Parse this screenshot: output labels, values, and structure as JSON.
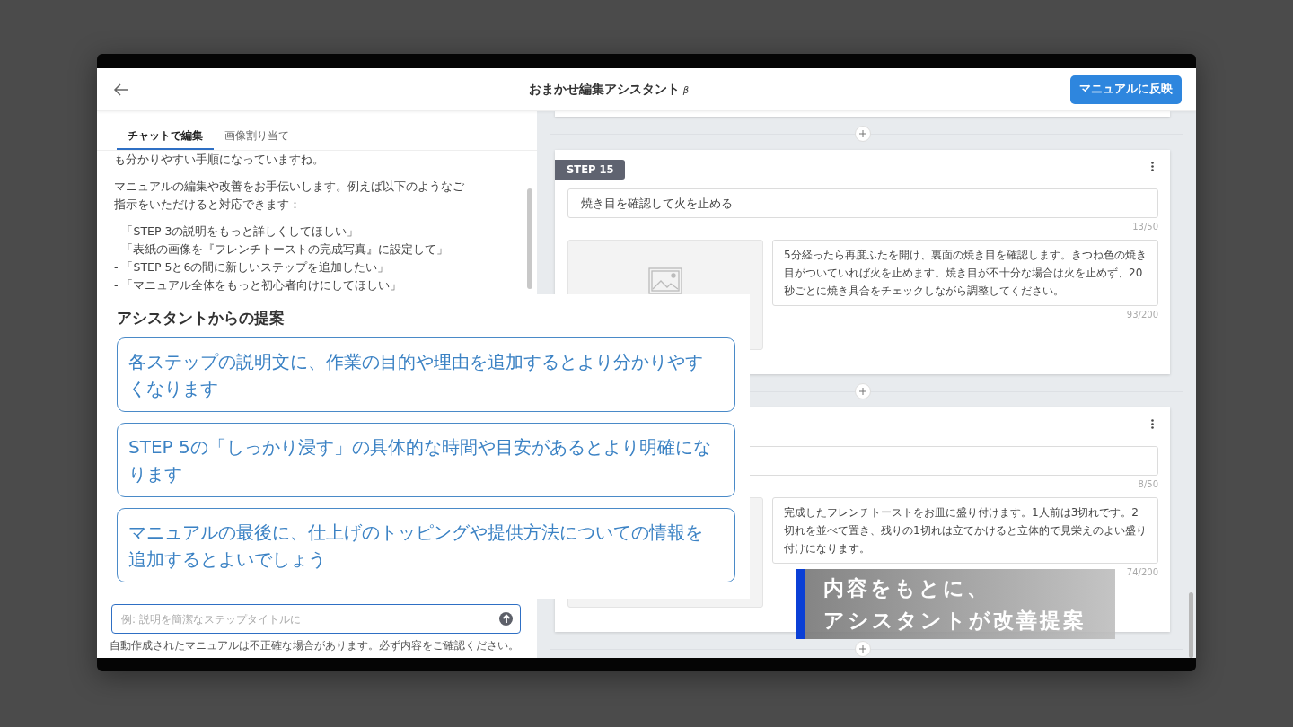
{
  "header": {
    "title": "おまかせ編集アシスタント",
    "beta": "β",
    "apply_button": "マニュアルに反映"
  },
  "tabs": [
    {
      "label": "チャットで編集",
      "selected": true
    },
    {
      "label": "画像割り当て",
      "selected": false
    }
  ],
  "chat": {
    "paragraphs": [
      [
        "も分かりやすい手順になっていますね。"
      ],
      [
        "マニュアルの編集や改善をお手伝いします。例えば以下のようなご",
        "指示をいただけると対応できます："
      ]
    ],
    "list": [
      "- 「STEP 3の説明をもっと詳しくしてほしい」",
      "- 「表紙の画像を『フレンチトーストの完成写真』に設定して」",
      "- 「STEP 5と6の間に新しいステップを追加したい」",
      "- 「マニュアル全体をもっと初心者向けにしてほしい」"
    ]
  },
  "input": {
    "placeholder": "例: 説明を簡潔なステップタイトルに"
  },
  "disclaimer": "自動作成されたマニュアルは不正確な場合があります。必ず内容をご確認ください。",
  "steps": [
    {
      "label": "STEP 15",
      "title": "焼き目を確認して火を止める",
      "title_count": "13/50",
      "description": "5分経ったら再度ふたを開け、裏面の焼き目を確認します。きつね色の焼き目がついていれば火を止めます。焼き目が不十分な場合は火を止めず、20秒ごとに焼き具合をチェックしながら調整してください。",
      "description_count": "93/200"
    },
    {
      "title_count": "8/50",
      "description": "完成したフレンチトーストをお皿に盛り付けます。1人前は3切れです。2切れを並べて置き、残りの1切れは立てかけると立体的で見栄えのよい盛り付けになります。",
      "description_count": "74/200"
    }
  ],
  "suggestions": {
    "title": "アシスタントからの提案",
    "items": [
      "各ステップの説明文に、作業の目的や理由を追加するとより分かりやすくなります",
      "STEP 5の「しっかり浸す」の具体的な時間や目安があるとより明確になります",
      "マニュアルの最後に、仕上げのトッピングや提供方法についての情報を追加するとよいでしょう"
    ]
  },
  "caption": {
    "lines": [
      "内容をもとに、",
      "アシスタントが改善提案"
    ]
  }
}
